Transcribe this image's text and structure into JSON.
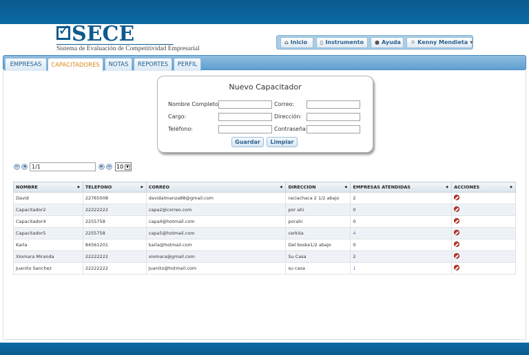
{
  "logo": {
    "title": "SECE",
    "subtitle": "Sistema de Evaluación de Competitividad Empresarial"
  },
  "topnav": [
    {
      "label": "Inicio",
      "icon": "home-icon"
    },
    {
      "label": "Instrumento",
      "icon": "document-icon"
    },
    {
      "label": "Ayuda",
      "icon": "info-icon"
    },
    {
      "label": "Kenny Mendieta",
      "icon": "user-icon"
    }
  ],
  "tabs": [
    {
      "label": "EMPRESAS",
      "active": false
    },
    {
      "label": "CAPACITADORES",
      "active": true
    },
    {
      "label": "NOTAS",
      "active": false
    },
    {
      "label": "REPORTES",
      "active": false
    },
    {
      "label": "PERFIL",
      "active": false
    }
  ],
  "form": {
    "title": "Nuevo Capacitador",
    "nombre_label": "Nombre Completo:",
    "correo_label": "Correo:",
    "cargo_label": "Cargo:",
    "direccion_label": "Dirección:",
    "telefono_label": "Teléfono:",
    "contrasena_label": "Contraseña:",
    "save_label": "Guardar",
    "clear_label": "Limpiar"
  },
  "pager": {
    "page_value": "1/1",
    "page_size": "10"
  },
  "grid": {
    "columns": [
      "NOMBRE",
      "TELEFONO",
      "CORREO",
      "DIRECCION",
      "EMPRESAS ATENDIDAS",
      "ACCIONES"
    ],
    "rows": [
      [
        "David",
        "22765008",
        "davidalmanza88@gmail.com",
        "raciachaca 2 1/2 abajo",
        "2"
      ],
      [
        "Capacitador2",
        "22222222",
        "capa2@correo.com",
        "por ahi",
        "0"
      ],
      [
        "Capacitador4",
        "2255758",
        "capa4@hotmail.com",
        "porahi",
        "0"
      ],
      [
        "Capacitador5",
        "2255758",
        "capa5@hotmail.com",
        "cerkita",
        "4"
      ],
      [
        "Karla",
        "84561201",
        "karla@hotmail.com",
        "Del boske1/2 abajo",
        "0"
      ],
      [
        "Xiomara Miranda",
        "22222222",
        "xiomara@gmail.com",
        "Su Casa",
        "2"
      ],
      [
        "Juanito Sanchez",
        "22222222",
        "Juanito@hotmail.com",
        "su casa",
        "1"
      ]
    ]
  },
  "colors": {
    "brand": "#0d5a8f",
    "active_tab": "#d98a1a",
    "delete": "#d0372b"
  }
}
